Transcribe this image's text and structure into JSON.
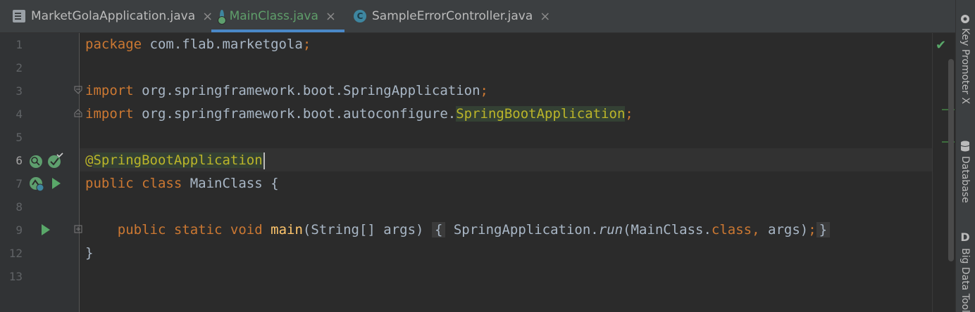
{
  "tabs": [
    {
      "label": "MarketGolaApplication.java",
      "icon": "file-icon",
      "close": "×"
    },
    {
      "label": "MainClass.java",
      "icon": "spring-class-icon",
      "close": "×"
    },
    {
      "label": "SampleErrorController.java",
      "icon": "class-icon",
      "close": "×"
    }
  ],
  "gutter": {
    "line_numbers": [
      "1",
      "2",
      "3",
      "4",
      "5",
      "6",
      "7",
      "8",
      "9",
      "12",
      "13"
    ]
  },
  "code": {
    "l1_kw": "package",
    "l1_rest": " com.flab.marketgola",
    "l1_semi": ";",
    "l3_kw": "import",
    "l3_rest": " org.springframework.boot.SpringApplication",
    "l3_semi": ";",
    "l4_kw": "import",
    "l4_rest": " org.springframework.boot.autoconfigure.",
    "l4_hl": "SpringBootApplication",
    "l4_semi": ";",
    "l6_at": "@",
    "l6_ann": "SpringBootApplication",
    "l7_kw": "public class",
    "l7_rest": " MainClass {",
    "l9_kw": "public static void",
    "l9_fn": "main",
    "l9_params": "(String[] args)",
    "l9_fold_open": "{",
    "l9_call": "SpringApplication.",
    "l9_run": "run",
    "l9_args1": "(MainClass.",
    "l9_class": "class, ",
    "l9_args2": "args)",
    "l9_semi": ";",
    "l9_fold_close": "}",
    "l12": "}"
  },
  "status": {
    "check": "✔"
  },
  "right_panels": [
    {
      "label": "Key Promoter X",
      "icon": "key-promoter-icon"
    },
    {
      "label": "Database",
      "icon": "database-icon"
    },
    {
      "label": "Big Data Tools",
      "icon": "big-data-tools-icon",
      "icon_glyph": "D"
    }
  ],
  "colors": {
    "keyword": "#cc7832",
    "annotation": "#bbb529",
    "method": "#ffc66d",
    "text": "#a9b7c6",
    "active_tab": "#5f9e6a"
  }
}
